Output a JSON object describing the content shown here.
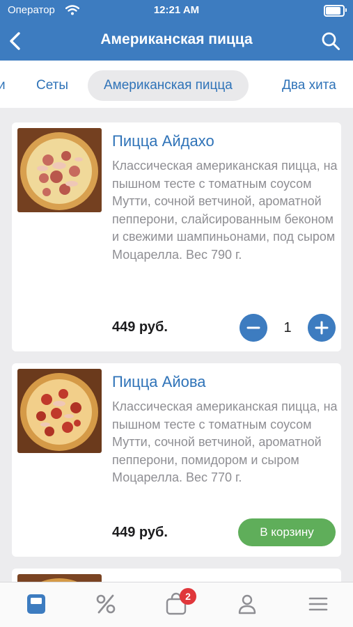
{
  "status_bar": {
    "carrier": "Оператор",
    "time": "12:21 AM"
  },
  "nav": {
    "title": "Американская пицца"
  },
  "tabs": [
    {
      "label": "и"
    },
    {
      "label": "Сеты"
    },
    {
      "label": "Американская пицца",
      "active": true
    },
    {
      "label": "Два хита"
    }
  ],
  "products": [
    {
      "name": "Пицца Айдахо",
      "description": "Классическая американская пицца, на пышном тесте с томатным соусом Мутти, сочной ветчиной, ароматной пепперони, слайсированным беконом и свежими шампиньонами, под сыром Моцарелла. Вес 790 г.",
      "price": "449 руб.",
      "quantity": "1"
    },
    {
      "name": "Пицца Айова",
      "description": "Классическая американская пицца, на пышном тесте с томатным соусом Мутти, сочной ветчиной, ароматной пепперони, помидором и сыром Моцарелла. Вес 770 г.",
      "price": "449 руб.",
      "cart_label": "В корзину"
    }
  ],
  "tab_bar": {
    "items": [
      "menu-icon",
      "percent-icon",
      "cart-icon",
      "profile-icon",
      "hamburger-icon"
    ],
    "cart_badge": "2"
  },
  "colors": {
    "brand": "#3d7cc0",
    "accent_green": "#5fae5a",
    "badge_red": "#e0373b"
  }
}
